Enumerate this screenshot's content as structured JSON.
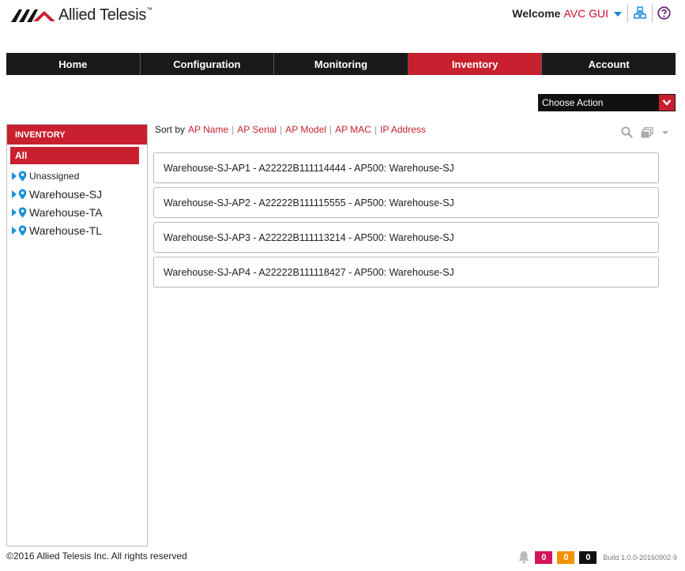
{
  "brand": {
    "name": "Allied Telesis",
    "tm": "™"
  },
  "header": {
    "welcome_label": "Welcome",
    "user_name": "AVC GUI"
  },
  "nav": {
    "items": [
      {
        "label": "Home"
      },
      {
        "label": "Configuration"
      },
      {
        "label": "Monitoring"
      },
      {
        "label": "Inventory"
      },
      {
        "label": "Account"
      }
    ],
    "active": "Inventory"
  },
  "action": {
    "label": "Choose Action"
  },
  "sidebar": {
    "header": "INVENTORY",
    "all_label": "All",
    "items": [
      {
        "label": "Unassigned"
      },
      {
        "label": "Warehouse-SJ"
      },
      {
        "label": "Warehouse-TA"
      },
      {
        "label": "Warehouse-TL"
      }
    ]
  },
  "sort": {
    "label": "Sort by",
    "options": [
      "AP Name",
      "AP Serial",
      "AP Model",
      "AP MAC",
      "IP Address"
    ]
  },
  "aps": [
    "Warehouse-SJ-AP1 - A22222B111114444 - AP500: Warehouse-SJ",
    "Warehouse-SJ-AP2 - A22222B111115555 - AP500: Warehouse-SJ",
    "Warehouse-SJ-AP3 - A22222B111113214 - AP500: Warehouse-SJ",
    "Warehouse-SJ-AP4 - A22222B111118427 - AP500: Warehouse-SJ"
  ],
  "footer": {
    "copyright": "©2016 Allied Telesis Inc. All rights reserved",
    "badges": [
      {
        "value": "0",
        "color": "#d4145a"
      },
      {
        "value": "0",
        "color": "#f39200"
      },
      {
        "value": "0",
        "color": "#111111"
      }
    ],
    "build": "Build 1.0.0-20160902-9"
  },
  "colors": {
    "accent": "#c8202e",
    "nav_bg": "#1a1a1a",
    "link_blue": "#1a90d8"
  },
  "icons": [
    "logo-mark",
    "network-icon",
    "help-icon",
    "search-icon",
    "stack-icon",
    "bell-icon",
    "pin-icon"
  ]
}
